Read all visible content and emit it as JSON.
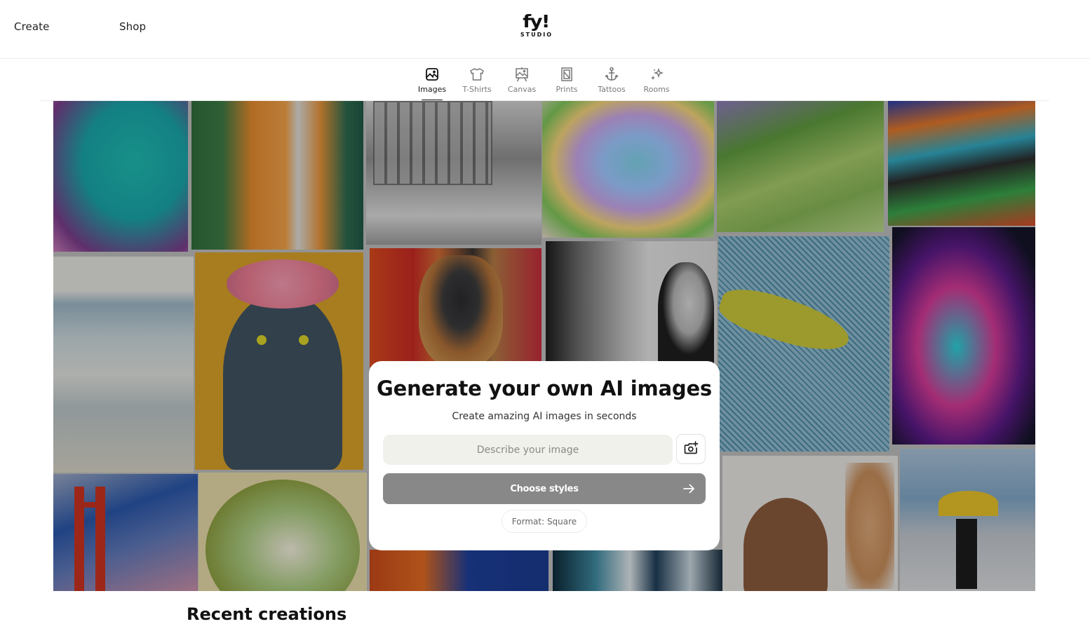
{
  "header": {
    "nav": [
      {
        "label": "Create"
      },
      {
        "label": "Shop"
      }
    ],
    "logo": {
      "mark": "fy!",
      "sub": "STUDIO"
    }
  },
  "tabs": [
    {
      "label": "Images",
      "icon": "image-icon",
      "active": true
    },
    {
      "label": "T-Shirts",
      "icon": "tshirt-icon",
      "active": false
    },
    {
      "label": "Canvas",
      "icon": "easel-icon",
      "active": false
    },
    {
      "label": "Prints",
      "icon": "framed-print-icon",
      "active": false
    },
    {
      "label": "Tattoos",
      "icon": "anchor-icon",
      "active": false
    },
    {
      "label": "Rooms",
      "icon": "sparkles-icon",
      "active": false
    }
  ],
  "hero": {
    "collage_tiles": [
      "Teal and magenta portrait of a face",
      "Orange painting of figs and a tower",
      "Pencil sketch of a large house",
      "Watercolor rainbow teacup",
      "Garden with lavender and hillside",
      "Colorful dancers among flowers",
      "Watercolor beach fence",
      "Grey cat with a flower crown on yellow",
      "Painted puppy on red background",
      "Black and white city street with woman",
      "Yellow fish on blue crosshatch",
      "Neon anime girl with dark hair",
      "Golden Gate bridge at sunset",
      "Stylized green trees in oval",
      "Orange flowers on blue",
      "Blue and white floral swirls",
      "Line drawing of long-haired woman",
      "Woman with yellow umbrella in rain"
    ]
  },
  "generator": {
    "title": "Generate your own AI images",
    "subtitle": "Create amazing AI images in seconds",
    "prompt_placeholder": "Describe your image",
    "prompt_value": "",
    "upload_icon": "camera-plus-icon",
    "choose_styles_label": "Choose styles",
    "format_label": "Format: Square"
  },
  "recent": {
    "title": "Recent creations"
  }
}
